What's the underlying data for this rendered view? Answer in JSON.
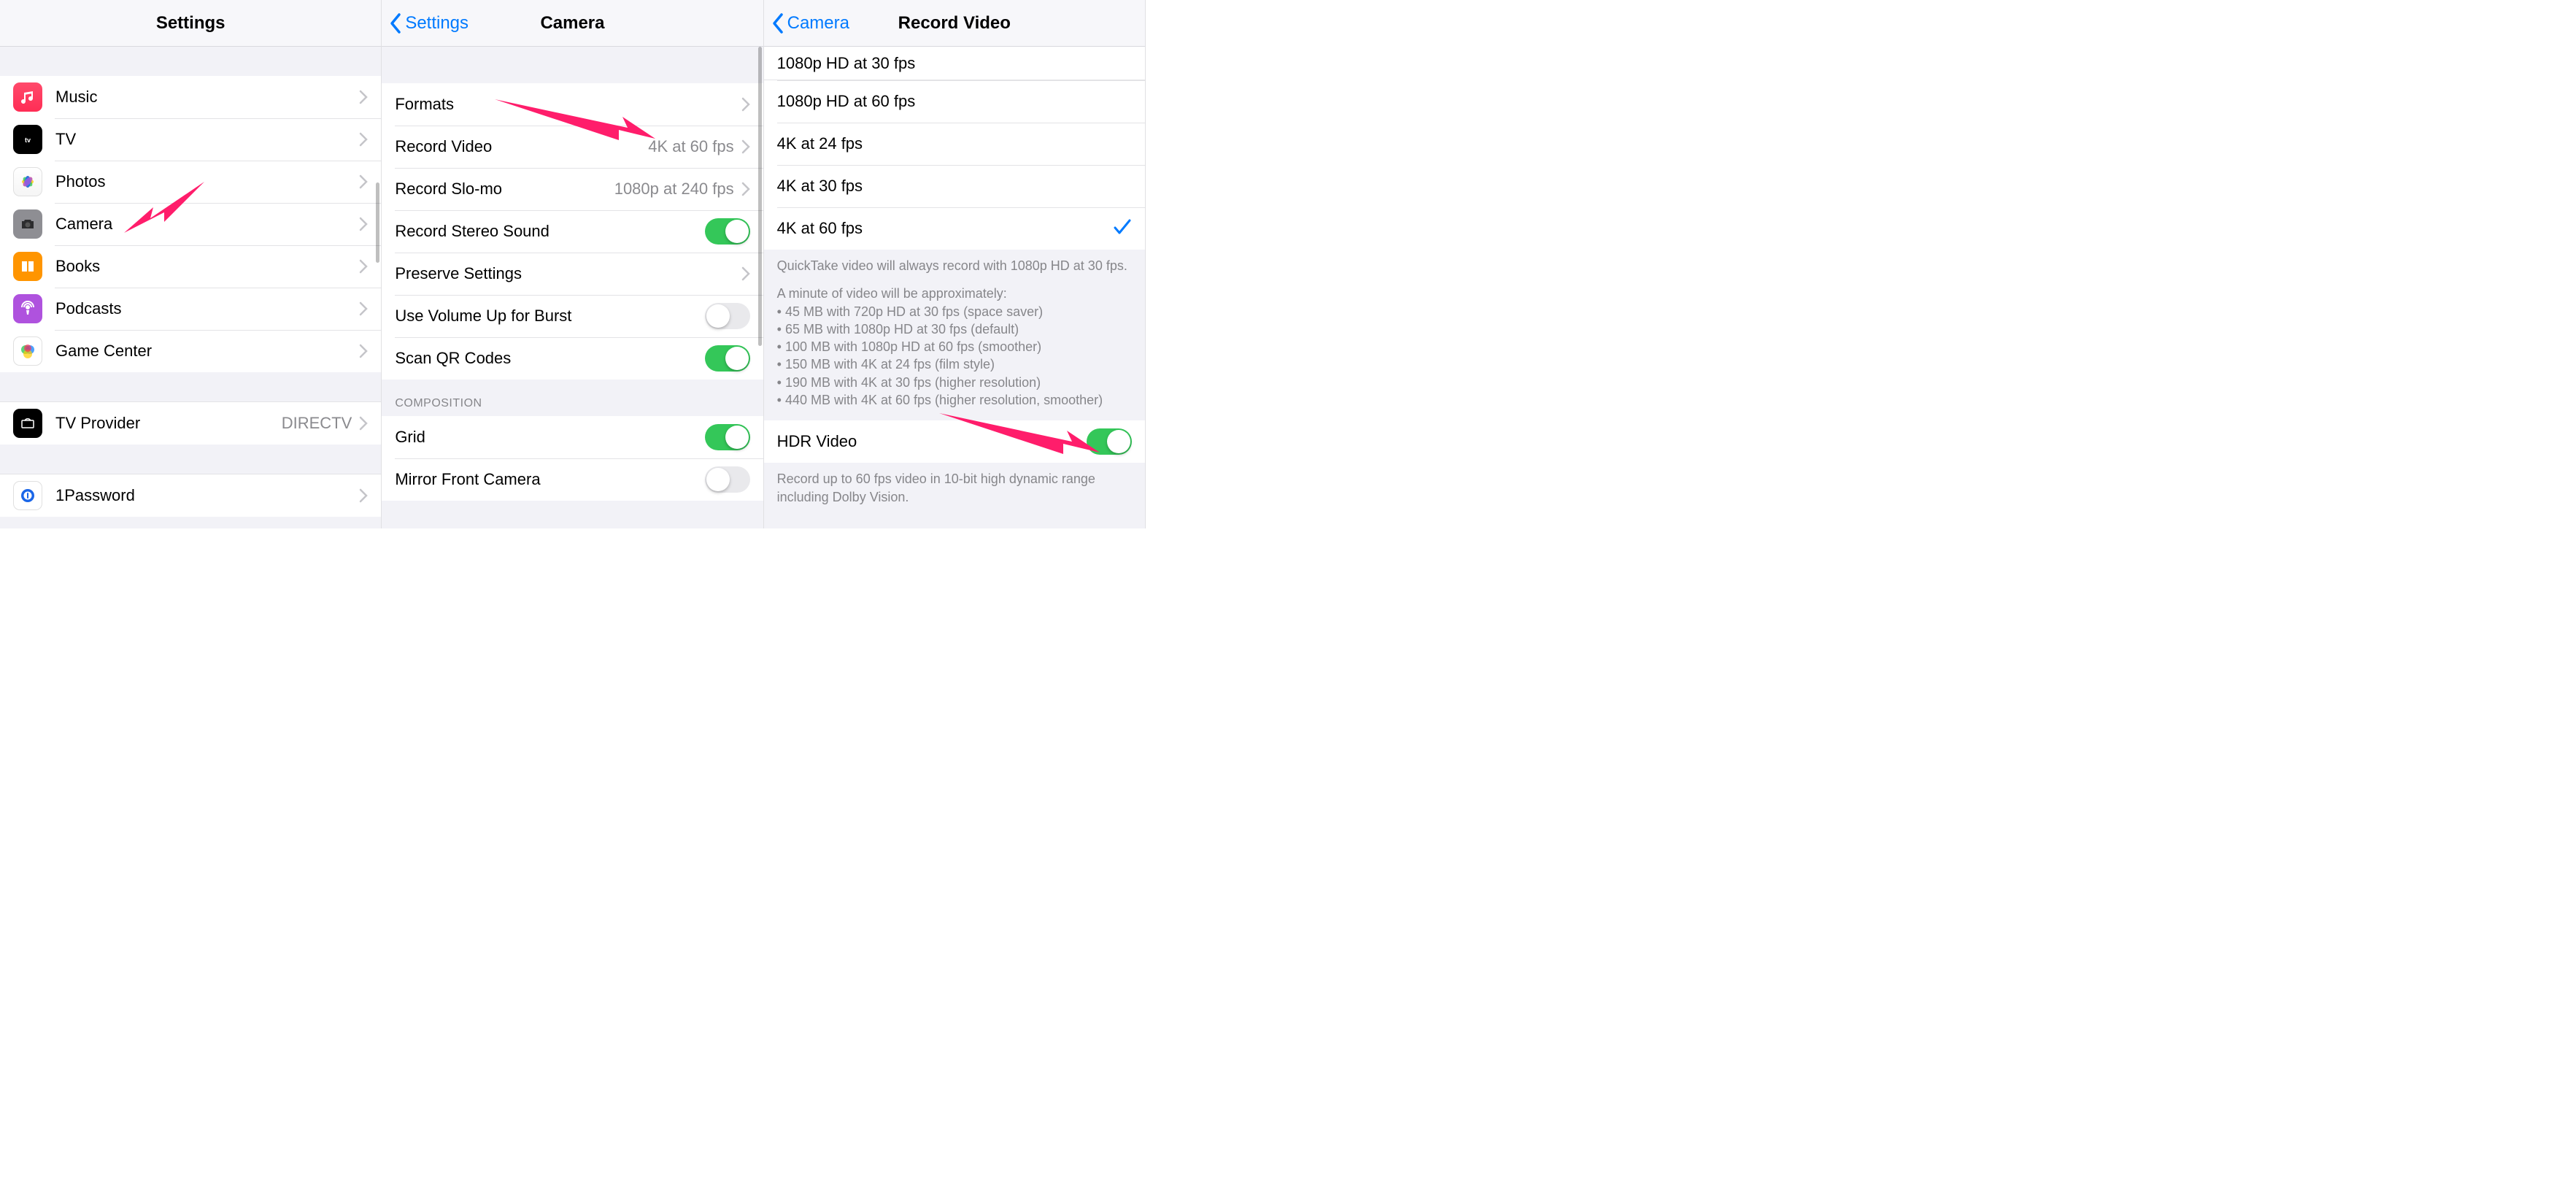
{
  "pane1": {
    "title": "Settings",
    "items": [
      {
        "label": "Music",
        "icon": "music-icon"
      },
      {
        "label": "TV",
        "icon": "tv-icon"
      },
      {
        "label": "Photos",
        "icon": "photos-icon"
      },
      {
        "label": "Camera",
        "icon": "camera-icon"
      },
      {
        "label": "Books",
        "icon": "books-icon"
      },
      {
        "label": "Podcasts",
        "icon": "podcasts-icon"
      },
      {
        "label": "Game Center",
        "icon": "game-center-icon"
      }
    ],
    "items2": [
      {
        "label": "TV Provider",
        "value": "DIRECTV",
        "icon": "tv-provider-icon"
      }
    ],
    "items3": [
      {
        "label": "1Password",
        "icon": "onepassword-icon"
      }
    ]
  },
  "pane2": {
    "back": "Settings",
    "title": "Camera",
    "rows": {
      "formats": "Formats",
      "record_video": "Record Video",
      "record_video_value": "4K at 60 fps",
      "record_slomo": "Record Slo-mo",
      "record_slomo_value": "1080p at 240 fps",
      "stereo": "Record Stereo Sound",
      "preserve": "Preserve Settings",
      "volume_burst": "Use Volume Up for Burst",
      "qr": "Scan QR Codes"
    },
    "composition_header": "Composition",
    "composition": {
      "grid": "Grid",
      "mirror": "Mirror Front Camera"
    }
  },
  "pane3": {
    "back": "Camera",
    "title": "Record Video",
    "options": [
      {
        "label": "1080p HD at 30 fps",
        "checked": false
      },
      {
        "label": "1080p HD at 60 fps",
        "checked": false
      },
      {
        "label": "4K at 24 fps",
        "checked": false
      },
      {
        "label": "4K at 30 fps",
        "checked": false
      },
      {
        "label": "4K at 60 fps",
        "checked": true
      }
    ],
    "footer1_line1": "QuickTake video will always record with 1080p HD at 30 fps.",
    "footer1_line2": "A minute of video will be approximately:",
    "footer1_bullets": [
      "45 MB with 720p HD at 30 fps (space saver)",
      "65 MB with 1080p HD at 30 fps (default)",
      "100 MB with 1080p HD at 60 fps (smoother)",
      "150 MB with 4K at 24 fps (film style)",
      "190 MB with 4K at 30 fps (higher resolution)",
      "440 MB with 4K at 60 fps (higher resolution, smoother)"
    ],
    "hdr_label": "HDR Video",
    "footer2": "Record up to 60 fps video in 10-bit high dynamic range including Dolby Vision."
  }
}
